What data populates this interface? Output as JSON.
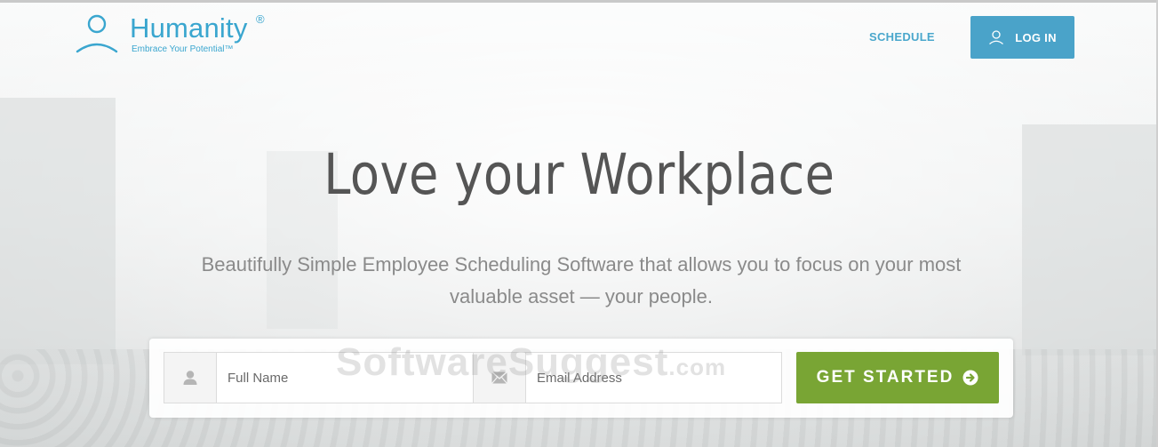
{
  "brand": {
    "name": "Humanity",
    "registered_mark": "®",
    "tagline": "Embrace Your Potential™",
    "color": "#3aa6cf"
  },
  "nav": {
    "schedule_label": "SCHEDULE",
    "login_label": "LOG IN",
    "login_icon": "user-icon",
    "login_color": "#4aa3c9"
  },
  "hero": {
    "headline": "Love your Workplace",
    "subheadline": "Beautifully Simple Employee Scheduling Software that allows you to focus on your most valuable asset — your people."
  },
  "signup": {
    "name_placeholder": "Full Name",
    "name_icon": "user-icon",
    "email_placeholder": "Email Address",
    "email_icon": "envelope-icon",
    "cta_label": "GET STARTED",
    "cta_icon": "arrow-circle-right-icon",
    "cta_color": "#79a534"
  },
  "watermark": {
    "text": "SoftwareSuggest",
    "suffix": ".com"
  }
}
